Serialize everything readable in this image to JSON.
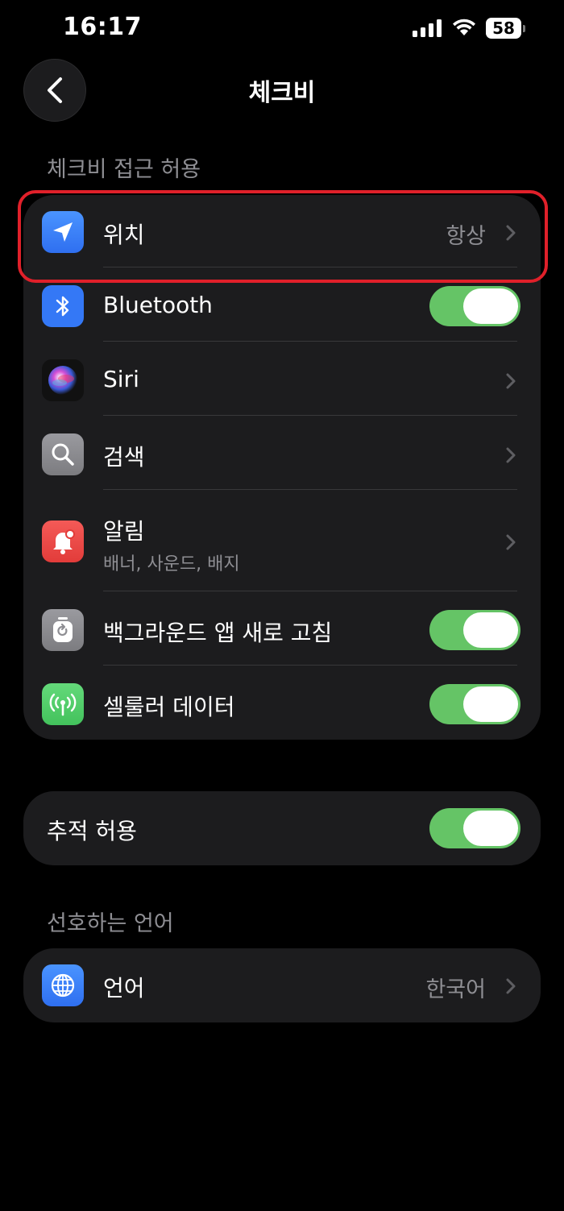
{
  "status_bar": {
    "time": "16:17",
    "battery": "58",
    "icons": [
      "cellular-signal-icon",
      "wifi-icon",
      "battery-icon"
    ]
  },
  "nav": {
    "title": "체크비",
    "back_icon": "chevron-left-icon"
  },
  "section_access": {
    "header": "체크비 접근 허용",
    "items": [
      {
        "label": "위치",
        "value": "항상",
        "icon": "location-arrow-icon",
        "icon_color": "#3b82f6",
        "accessory": "chevron"
      },
      {
        "label": "Bluetooth",
        "icon": "bluetooth-icon",
        "icon_color": "#3478f6",
        "accessory": "toggle",
        "on": true
      },
      {
        "label": "Siri",
        "icon": "siri-icon",
        "icon_color": "#111111",
        "accessory": "chevron"
      },
      {
        "label": "검색",
        "icon": "search-icon",
        "icon_color": "#8e8e93",
        "accessory": "chevron"
      },
      {
        "label": "알림",
        "subtitle": "배너, 사운드, 배지",
        "icon": "notification-bell-icon",
        "icon_color": "#eb4d4b",
        "accessory": "chevron"
      },
      {
        "label": "백그라운드 앱 새로 고침",
        "icon": "background-refresh-icon",
        "icon_color": "#8e8e93",
        "accessory": "toggle",
        "on": true
      },
      {
        "label": "셀룰러 데이터",
        "icon": "cellular-antenna-icon",
        "icon_color": "#4cd964",
        "accessory": "toggle",
        "on": true
      }
    ]
  },
  "tracking": {
    "label": "추적 허용",
    "on": true
  },
  "section_language": {
    "header": "선호하는 언어",
    "items": [
      {
        "label": "언어",
        "value": "한국어",
        "icon": "globe-icon",
        "icon_color": "#3478f6",
        "accessory": "chevron"
      }
    ]
  },
  "colors": {
    "background": "#000000",
    "group_background": "#1c1c1e",
    "toggle_on": "#65c466",
    "highlight": "#e0202a",
    "secondary_text": "#8e8e93"
  }
}
